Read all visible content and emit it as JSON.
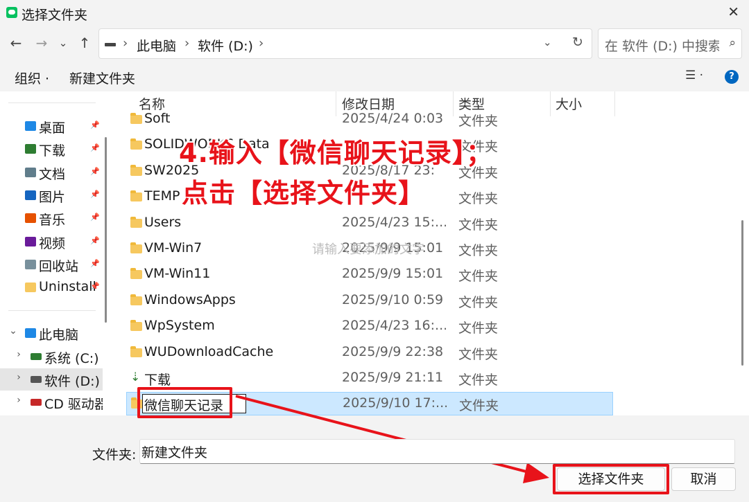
{
  "window": {
    "title": "选择文件夹",
    "close": "✕"
  },
  "nav": {
    "back": "←",
    "forward": "→",
    "recent": "⌄",
    "up": "↑"
  },
  "address": {
    "separator": "›",
    "crumbs": [
      "此电脑",
      "软件 (D:)"
    ],
    "dropdown": "⌄",
    "refresh": "↻"
  },
  "search": {
    "placeholder": "在 软件 (D:) 中搜索",
    "icon": "⌕"
  },
  "toolbar": {
    "organize": "组织 ·",
    "new_folder": "新建文件夹",
    "view": "☰ ·",
    "help": "?"
  },
  "sidebar": {
    "quick_access": [
      {
        "label": "桌面",
        "icon": "desktop-icon",
        "color": "#1e88e5"
      },
      {
        "label": "下载",
        "icon": "download-icon",
        "color": "#2e7d32"
      },
      {
        "label": "文档",
        "icon": "document-icon",
        "color": "#607d8b"
      },
      {
        "label": "图片",
        "icon": "pictures-icon",
        "color": "#1565c0"
      },
      {
        "label": "音乐",
        "icon": "music-icon",
        "color": "#e65100"
      },
      {
        "label": "视频",
        "icon": "video-icon",
        "color": "#6a1b9a"
      },
      {
        "label": "回收站",
        "icon": "recycle-bin-icon",
        "color": "#78909c"
      },
      {
        "label": "Uninstall",
        "icon": "folder-icon",
        "color": "#f6c85f"
      }
    ],
    "pin": "📌",
    "this_pc": {
      "label": "此电脑",
      "chevron": "⌄"
    },
    "drives": [
      {
        "label": "系统 (C:)",
        "chevron": "›"
      },
      {
        "label": "软件 (D:)",
        "chevron": "›"
      },
      {
        "label": "CD 驱动器",
        "chevron": "›"
      }
    ]
  },
  "columns": {
    "sort": "⌃",
    "name": "名称",
    "modified": "修改日期",
    "type": "类型",
    "size": "大小"
  },
  "files": [
    {
      "name": "Soft",
      "date": "2025/4/24 0:03",
      "type": "文件夹"
    },
    {
      "name": "SOLIDWORKS Data",
      "date": "",
      "type": "文件夹"
    },
    {
      "name": "SW2025",
      "date": "2025/8/17 23:",
      "type": "文件夹"
    },
    {
      "name": "TEMP",
      "date": "",
      "type": "文件夹"
    },
    {
      "name": "Users",
      "date": "2025/4/23 15:...",
      "type": "文件夹"
    },
    {
      "name": "VM-Win7",
      "date": "2025/9/9 15:01",
      "type": "文件夹"
    },
    {
      "name": "VM-Win11",
      "date": "2025/9/9 15:01",
      "type": "文件夹"
    },
    {
      "name": "WindowsApps",
      "date": "2025/9/10 0:59",
      "type": "文件夹"
    },
    {
      "name": "WpSystem",
      "date": "2025/4/23 16:...",
      "type": "文件夹"
    },
    {
      "name": "WUDownloadCache",
      "date": "2025/9/9 22:38",
      "type": "文件夹"
    },
    {
      "name": "下载",
      "date": "2025/9/9 21:11",
      "type": "文件夹"
    }
  ],
  "editing_row": {
    "name": "微信聊天记录",
    "date": "2025/9/10 17:...",
    "type": "文件夹"
  },
  "watermark": "请输入要添加的文字",
  "annotation": {
    "line1": "4.输入【微信聊天记录】；",
    "line2": "点击【选择文件夹】"
  },
  "footer": {
    "folder_label": "文件夹:",
    "folder_value": "新建文件夹",
    "select_button": "选择文件夹",
    "cancel_button": "取消"
  },
  "colors": {
    "annotation_red": "#e8131a",
    "selection": "#cce8ff",
    "folder": "#f6c85f",
    "accent": "#0067c0"
  }
}
